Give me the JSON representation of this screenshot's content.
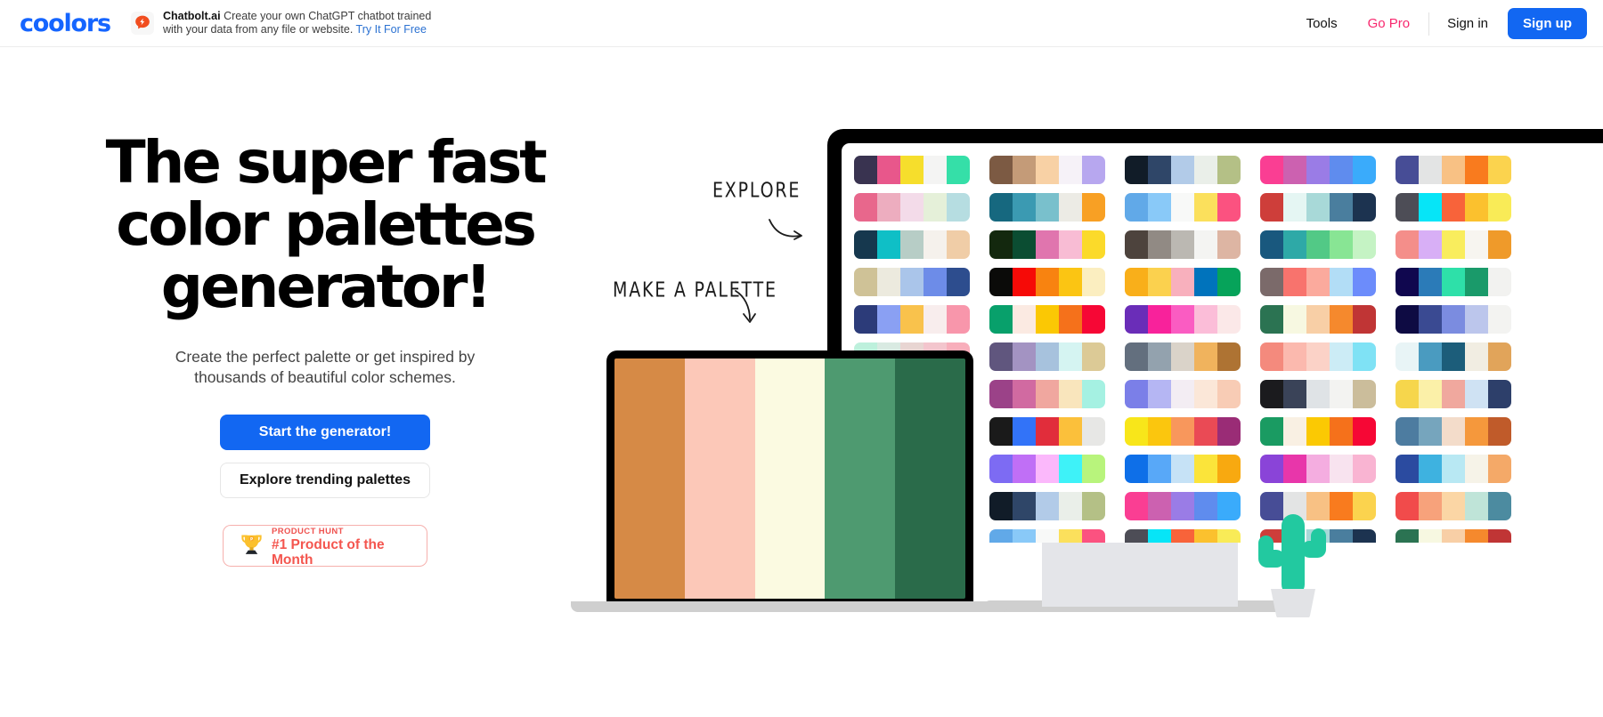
{
  "header": {
    "logo_text": "coolors",
    "logo_color": "#1565ff",
    "promo": {
      "icon_name": "chatbolt-bubble-icon",
      "brand": "Chatbolt.ai",
      "line1": "Create your own ChatGPT chatbot trained",
      "line2": "with your data from any file or website.",
      "link": "Try It For Free"
    },
    "nav": {
      "tools": "Tools",
      "go_pro": "Go Pro",
      "go_pro_color": "#f8286e",
      "sign_in": "Sign in",
      "sign_up": "Sign up",
      "sign_up_bg": "#1267f2"
    }
  },
  "hero": {
    "headline_line1": "The super fast",
    "headline_line2": "color palettes",
    "headline_line3": "generator!",
    "subtitle_line1": "Create the perfect palette or get inspired by",
    "subtitle_line2": "thousands of beautiful color schemes.",
    "primary_cta": "Start the generator!",
    "secondary_cta": "Explore trending palettes",
    "badge": {
      "icon_name": "trophy-icon",
      "kicker": "PRODUCT HUNT",
      "title": "#1 Product of the Month",
      "border_color": "#f6b0ad",
      "text_color": "#f4564f"
    }
  },
  "annotations": {
    "explore": "EXPLORE",
    "make_a_palette": "MAKE A PALETTE"
  },
  "laptop": {
    "palette": [
      "#d68a46",
      "#fcc8b8",
      "#fbfae1",
      "#4e9a70",
      "#2a6b4a"
    ]
  },
  "monitor": {
    "palettes": [
      [
        [
          "#393350",
          "#e8578b",
          "#f6de2c",
          "#f4f4f3",
          "#35dfa8"
        ],
        [
          "#7c5a43",
          "#c49b78",
          "#f8d1a5",
          "#f6f2f8",
          "#b7a7ef"
        ],
        [
          "#111c28",
          "#2f4668",
          "#b2cbe8",
          "#eaefe9",
          "#b4c086"
        ],
        [
          "#fa3e93",
          "#cc61b0",
          "#9a7ce6",
          "#5f8cee",
          "#3aabfb"
        ],
        [
          "#474d96",
          "#e3e4e4",
          "#f8c184",
          "#f97b1e",
          "#fbd34e"
        ]
      ],
      [
        [
          "#e8678c",
          "#edadbf",
          "#f3dbe9",
          "#e5f0d9",
          "#b6dde1"
        ],
        [
          "#16687f",
          "#3b9ab2",
          "#79c0cc",
          "#ecebe5",
          "#f8a024"
        ],
        [
          "#61a9e8",
          "#89c9f8",
          "#f8f9f8",
          "#fbe05c",
          "#fb5280"
        ],
        [
          "#ce3e3a",
          "#e5f6f3",
          "#a8d9d8",
          "#4a7e9e",
          "#1c3350"
        ],
        [
          "#4d4d56",
          "#06e5f7",
          "#f8633a",
          "#fbc12e",
          "#f9eb57"
        ]
      ],
      [
        [
          "#16384e",
          "#0fbfc6",
          "#b7cdc6",
          "#f5f1ec",
          "#f0cda7"
        ],
        [
          "#13280e",
          "#0b4d32",
          "#e075ae",
          "#f8bcd4",
          "#fbda2a"
        ],
        [
          "#4d433d",
          "#918a84",
          "#bbb8b2",
          "#f4f4f2",
          "#ddb5a3"
        ],
        [
          "#19587e",
          "#2ea9a7",
          "#52c986",
          "#88e594",
          "#c5f3c4"
        ],
        [
          "#f48e8a",
          "#d8aff6",
          "#f9ed5d",
          "#f7f5f0",
          "#ef9a2a"
        ]
      ],
      [
        [
          "#cfc297",
          "#eceade",
          "#aac5ea",
          "#6d8ce8",
          "#2d4d8e"
        ],
        [
          "#0b0b09",
          "#f60a07",
          "#f88310",
          "#fbc513",
          "#fbeec0"
        ],
        [
          "#f9af1a",
          "#fbd14e",
          "#f8b0bd",
          "#0073bc",
          "#06a35a"
        ],
        [
          "#7b6a6a",
          "#f8736d",
          "#fbaa9d",
          "#b2ddf6",
          "#6c8cfb"
        ],
        [
          "#10074f",
          "#2b7bb8",
          "#2ee0a9",
          "#1a9a6a",
          "#f2f2f0"
        ]
      ],
      [
        [
          "#2c3b79",
          "#8aa0f3",
          "#f9c24c",
          "#f8eded",
          "#f896ab"
        ],
        [
          "#08a06b",
          "#fbeae2",
          "#fbc804",
          "#f5711b",
          "#f60735"
        ],
        [
          "#6a2db8",
          "#f8229b",
          "#fa5cc2",
          "#fbbdd8",
          "#fbe8e8"
        ],
        [
          "#2b7352",
          "#f7f8e1",
          "#f8cfa6",
          "#f5892d",
          "#c03535"
        ],
        [
          "#0e0b43",
          "#3a4a92",
          "#7b8ce0",
          "#bcc6ec",
          "#f3f3f1"
        ]
      ],
      [
        [
          "#bdf0dc",
          "#d9eae2",
          "#e8d5d2",
          "#f3c5cd",
          "#f8aebb"
        ],
        [
          "#60567e",
          "#a393c2",
          "#a7c2dd",
          "#d5f4f2",
          "#dcca96"
        ],
        [
          "#636f7e",
          "#93a2ae",
          "#dad3c9",
          "#f0b35d",
          "#ae7333"
        ],
        [
          "#f48a7d",
          "#fbb9ae",
          "#fbd2c7",
          "#ccecf6",
          "#7fe2f5"
        ],
        [
          "#e8f4f6",
          "#4a9bc0",
          "#1c5d7a",
          "#f1ede2",
          "#e1a45a"
        ]
      ],
      [
        [
          "#f08f89",
          "#f4a9a3",
          "#c6bcc2",
          "#aed0d6",
          "#a5f4f5"
        ],
        [
          "#9b4288",
          "#d16aa1",
          "#f0a79f",
          "#f9e5bc",
          "#a5f1e2"
        ],
        [
          "#7b7fe8",
          "#b5b6f3",
          "#f3edf3",
          "#fbe7d8",
          "#f8ccb5"
        ],
        [
          "#1b1b1e",
          "#3a4358",
          "#dfe3e6",
          "#f3f3f1",
          "#cbbd9b"
        ],
        [
          "#f6d64c",
          "#fbf0a8",
          "#f0a89e",
          "#cfe2f3",
          "#2d3f6a"
        ]
      ],
      [
        [
          "#aed8e8",
          "#f6a51f",
          "#fbd75c",
          "#4d9b2b",
          "#1d5c11"
        ],
        [
          "#1a1a1a",
          "#3273f8",
          "#e12d3b",
          "#fbc03b",
          "#e7e7e5"
        ],
        [
          "#f8e61a",
          "#fbc60e",
          "#f8975c",
          "#ea4a55",
          "#9a2c76"
        ],
        [
          "#1a9b62",
          "#f9f0e3",
          "#fbc903",
          "#f5711b",
          "#f60735"
        ],
        [
          "#4d7ca0",
          "#76a5bd",
          "#f3dcca",
          "#f5983c",
          "#c05b2a"
        ]
      ],
      [
        [
          "#0e2db8",
          "#1189f4",
          "#8fc9f2",
          "#f9e80e",
          "#fbb20b"
        ],
        [
          "#7d6bf3",
          "#c06ff6",
          "#fbb8fb",
          "#3ef2f8",
          "#b8f47c"
        ],
        [
          "#0e6fe8",
          "#58a8f8",
          "#c6e2f6",
          "#fbe43a",
          "#f8a910"
        ],
        [
          "#8a44d8",
          "#e836aa",
          "#f4ade0",
          "#f8e3ef",
          "#f9b4d2"
        ],
        [
          "#2b4ba0",
          "#3eb2e0",
          "#b8e8f3",
          "#f6f3e8",
          "#f4a968"
        ]
      ],
      [
        [
          "#7c5a43",
          "#c49b78",
          "#f8d1a5",
          "#f6f2f8",
          "#b7a7ef"
        ],
        [
          "#111c28",
          "#2f4668",
          "#b2cbe8",
          "#eaefe9",
          "#b4c086"
        ],
        [
          "#fa3e93",
          "#cc61b0",
          "#9a7ce6",
          "#5f8cee",
          "#3aabfb"
        ],
        [
          "#474d96",
          "#e3e4e4",
          "#f8c184",
          "#f97b1e",
          "#fbd34e"
        ],
        [
          "#f14b4b",
          "#f7a27b",
          "#fbd6a5",
          "#bfe4d8",
          "#4c8ba0"
        ]
      ],
      [
        [
          "#16687f",
          "#3b9ab2",
          "#79c0cc",
          "#ecebe5",
          "#f8a024"
        ],
        [
          "#61a9e8",
          "#89c9f8",
          "#f8f9f8",
          "#fbe05c",
          "#fb5280"
        ],
        [
          "#4d4d56",
          "#06e5f7",
          "#f8633a",
          "#fbc12e",
          "#f9eb57"
        ],
        [
          "#ce3e3a",
          "#e5f6f3",
          "#a8d9d8",
          "#4a7e9e",
          "#1c3350"
        ],
        [
          "#2b7352",
          "#f7f8e1",
          "#f8cfa6",
          "#f5892d",
          "#c03535"
        ]
      ]
    ]
  },
  "decor": {
    "cactus_color": "#22c9a0",
    "pot_color": "#e2e3e6"
  }
}
